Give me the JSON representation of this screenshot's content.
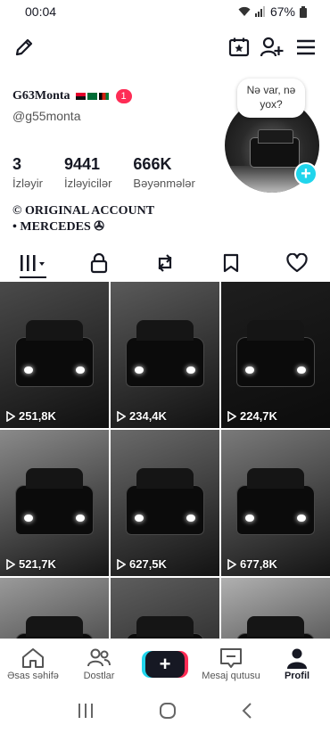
{
  "status_bar": {
    "time": "00:04",
    "battery": "67%"
  },
  "profile": {
    "display_name": "G63Monta",
    "notification_count": "1",
    "handle": "@g55monta",
    "bubble_text": "Nə var, nə yox?",
    "bio_line1": "© ORIGINAL ACCOUNT",
    "bio_line2": "• MERCEDES ✇"
  },
  "stats": [
    {
      "value": "3",
      "label": "İzləyir"
    },
    {
      "value": "9441",
      "label": "İzləyicilər"
    },
    {
      "value": "666K",
      "label": "Bəyənmələr"
    }
  ],
  "videos": [
    {
      "views": "251,8K",
      "tone": "#4a4a4a"
    },
    {
      "views": "234,4K",
      "tone": "#5a5a5a"
    },
    {
      "views": "224,7K",
      "tone": "#1e1e1e"
    },
    {
      "views": "521,7K",
      "tone": "#8a8a8a"
    },
    {
      "views": "627,5K",
      "tone": "#6a6a6a"
    },
    {
      "views": "677,8K",
      "tone": "#7a7a7a"
    },
    {
      "views": "",
      "tone": "#9a9a9a"
    },
    {
      "views": "",
      "tone": "#5e5e5e"
    },
    {
      "views": "",
      "tone": "#b0b0b0"
    }
  ],
  "nav": {
    "home": "Əsas səhifə",
    "friends": "Dostlar",
    "inbox": "Mesaj qutusu",
    "profile": "Profil"
  },
  "colors": {
    "accent_red": "#fe2c55",
    "accent_cyan": "#20d5ec"
  }
}
